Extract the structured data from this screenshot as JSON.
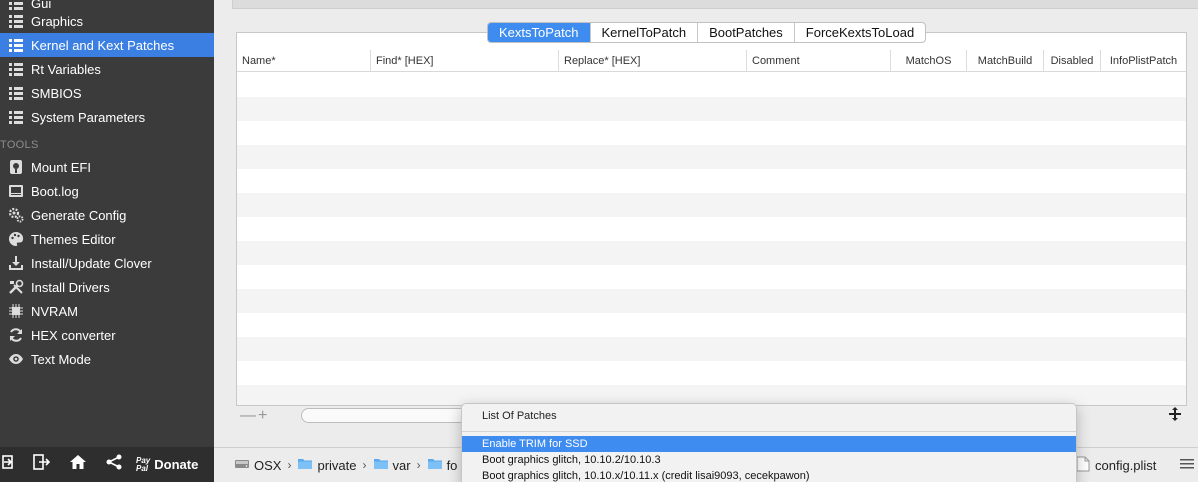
{
  "sidebar": {
    "items": [
      {
        "label": "Gui",
        "icon": "list-icon",
        "selected": false
      },
      {
        "label": "Graphics",
        "icon": "list-icon",
        "selected": false
      },
      {
        "label": "Kernel and Kext Patches",
        "icon": "list-icon",
        "selected": true
      },
      {
        "label": "Rt Variables",
        "icon": "list-icon",
        "selected": false
      },
      {
        "label": "SMBIOS",
        "icon": "list-icon",
        "selected": false
      },
      {
        "label": "System Parameters",
        "icon": "list-icon",
        "selected": false
      }
    ],
    "tools_header": "TOOLS",
    "tools": [
      {
        "label": "Mount EFI",
        "icon": "disk-icon"
      },
      {
        "label": "Boot.log",
        "icon": "log-icon"
      },
      {
        "label": "Generate Config",
        "icon": "gears-icon"
      },
      {
        "label": "Themes Editor",
        "icon": "palette-icon"
      },
      {
        "label": "Install/Update Clover",
        "icon": "download-icon"
      },
      {
        "label": "Install Drivers",
        "icon": "wrench-icon"
      },
      {
        "label": "NVRAM",
        "icon": "chip-icon"
      },
      {
        "label": "HEX converter",
        "icon": "convert-icon"
      },
      {
        "label": "Text Mode",
        "icon": "eye-icon"
      }
    ]
  },
  "bottom_toolbar": {
    "paypal_top": "Pay",
    "paypal_bottom": "Pal",
    "donate_label": "Donate"
  },
  "tabs": [
    {
      "label": "KextsToPatch",
      "active": true
    },
    {
      "label": "KernelToPatch",
      "active": false
    },
    {
      "label": "BootPatches",
      "active": false
    },
    {
      "label": "ForceKextsToLoad",
      "active": false
    }
  ],
  "table": {
    "columns": [
      "Name*",
      "Find* [HEX]",
      "Replace* [HEX]",
      "Comment",
      "MatchOS",
      "MatchBuild",
      "Disabled",
      "InfoPlistPatch"
    ],
    "rows": []
  },
  "table_footer": {
    "add_remove": "—+"
  },
  "pathbar": {
    "crumbs": [
      "OSX",
      "private",
      "var",
      "fo"
    ],
    "file": "config.plist"
  },
  "menu": {
    "title": "List Of Patches",
    "items": [
      {
        "label": "Enable TRIM for SSD",
        "highlighted": true
      },
      {
        "label": "Boot graphics glitch, 10.10.2/10.10.3",
        "highlighted": false
      },
      {
        "label": "Boot graphics glitch, 10.10.x/10.11.x (credit lisai9093, cecekpawon)",
        "highlighted": false
      }
    ]
  },
  "colors": {
    "sidebar_bg": "#3b3b3b",
    "selection": "#3b7fe3",
    "tab_active": "#3f8cf0"
  }
}
